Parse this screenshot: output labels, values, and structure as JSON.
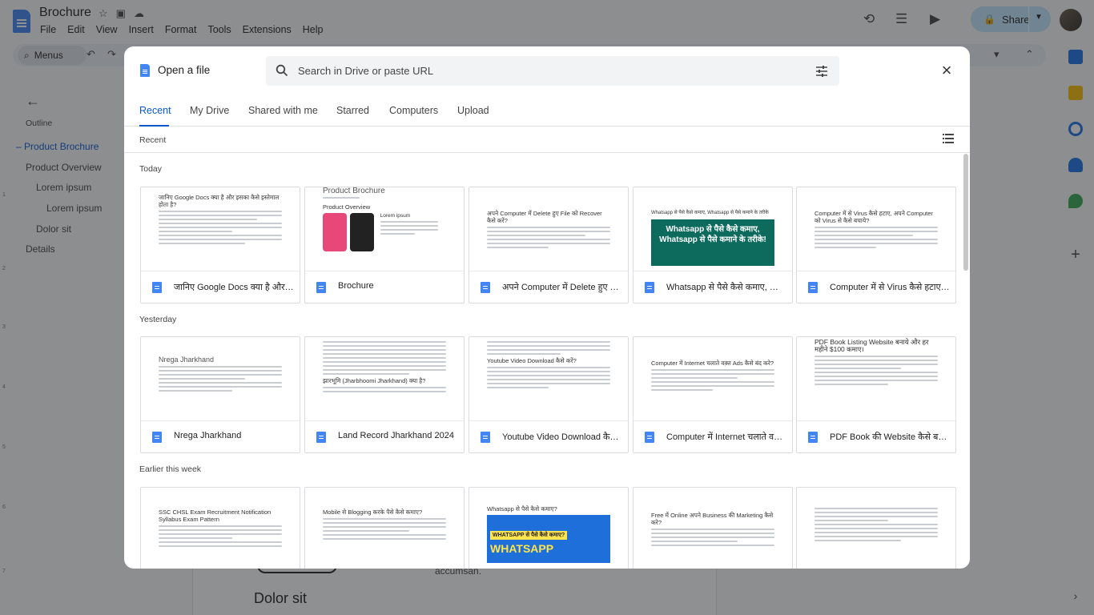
{
  "app": {
    "doc_title": "Brochure",
    "menu": [
      "File",
      "Edit",
      "View",
      "Insert",
      "Format",
      "Tools",
      "Extensions",
      "Help"
    ],
    "share_label": "Share",
    "toolbar_search": "Menus",
    "outline_title": "Outline",
    "outline_items": [
      "Product Brochure",
      "Product Overview",
      "Lorem ipsum",
      "Lorem ipsum",
      "Dolor sit",
      "Details"
    ],
    "page_heading": "Dolor sit",
    "page_text": "accumsan."
  },
  "dialog": {
    "title": "Open a file",
    "search_placeholder": "Search in Drive or paste URL",
    "tabs": [
      "Recent",
      "My Drive",
      "Shared with me",
      "Starred",
      "Computers",
      "Upload"
    ],
    "active_tab": "Recent",
    "section_label": "Recent",
    "groups": [
      {
        "label": "Today",
        "files": [
          {
            "name": "जानिए Google Docs क्या है और इसका कैसे इस्तेमाल होता है?",
            "thumb_title": "जानिए Google Docs क्या है और इसका कैसे इस्तेमाल होता है?"
          },
          {
            "name": "Brochure",
            "thumb_title": "Product Brochure"
          },
          {
            "name": "अपने Computer में Delete हुए File को Recover कैसे करें?",
            "thumb_title": "अपने Computer में Delete हुए File को Recover कैसे करें?"
          },
          {
            "name": "Whatsapp से पैसे कैसे कमाए, Whatsapp से पैसे कमाने के तरीके",
            "thumb_title": "Whatsapp से पैसे कैसे कमाए, Whatsapp से पैसे कमाने के तरीके"
          },
          {
            "name": "Computer में से Virus कैसे हटाए, अपने Computer को Virus से कैसे बचाये?",
            "thumb_title": "Computer में से Virus कैसे हटाए, अपने Computer को Virus से कैसे बचाये?"
          }
        ]
      },
      {
        "label": "Yesterday",
        "files": [
          {
            "name": "Nrega Jharkhand",
            "thumb_title": "Nrega Jharkhand"
          },
          {
            "name": "Land Record Jharkhand 2024",
            "thumb_title": "झारभूमि (Jharbhoomi Jharkhand) क्या है?"
          },
          {
            "name": "Youtube Video Download कैसे करें?",
            "thumb_title": "Youtube Video Download कैसे करें?"
          },
          {
            "name": "Computer में Internet चलाते वक़्त Ads कैसे बंद करे?",
            "thumb_title": "Computer में Internet चलाते वक़्त Ads कैसे बंद करे?"
          },
          {
            "name": "PDF Book की Website कैसे बनाये?",
            "thumb_title": "PDF Book Listing Website बनाये और हर महीने $100 कमाए।"
          }
        ]
      },
      {
        "label": "Earlier this week",
        "files": [
          {
            "name": "",
            "thumb_title": "SSC CHSL Exam Recruitment Notification Syllabus Exam Pattern"
          },
          {
            "name": "",
            "thumb_title": "Mobile से Blogging करके पैसे कैसे कमाए?"
          },
          {
            "name": "",
            "thumb_title": "Whatsapp से पैसे कैसे कमाए?"
          },
          {
            "name": "",
            "thumb_title": "Free में Online अपने Business की Marketing कैसे करे?"
          },
          {
            "name": "",
            "thumb_title": ""
          }
        ]
      }
    ],
    "banners": {
      "whatsapp_today": "Whatsapp से पैसे कैसे कमाए, Whatsapp से पैसे कमाने के तरीके!",
      "whatsapp_week_line1": "WHATSAPP से पैसे कैसे कमाए?",
      "whatsapp_week_line2": "WHATSAPP"
    }
  },
  "colors": {
    "accent": "#0b57d0",
    "docs_blue": "#4285f4",
    "share_bg": "#c2e7ff",
    "scrim": "rgba(32,33,36,0.5)"
  }
}
